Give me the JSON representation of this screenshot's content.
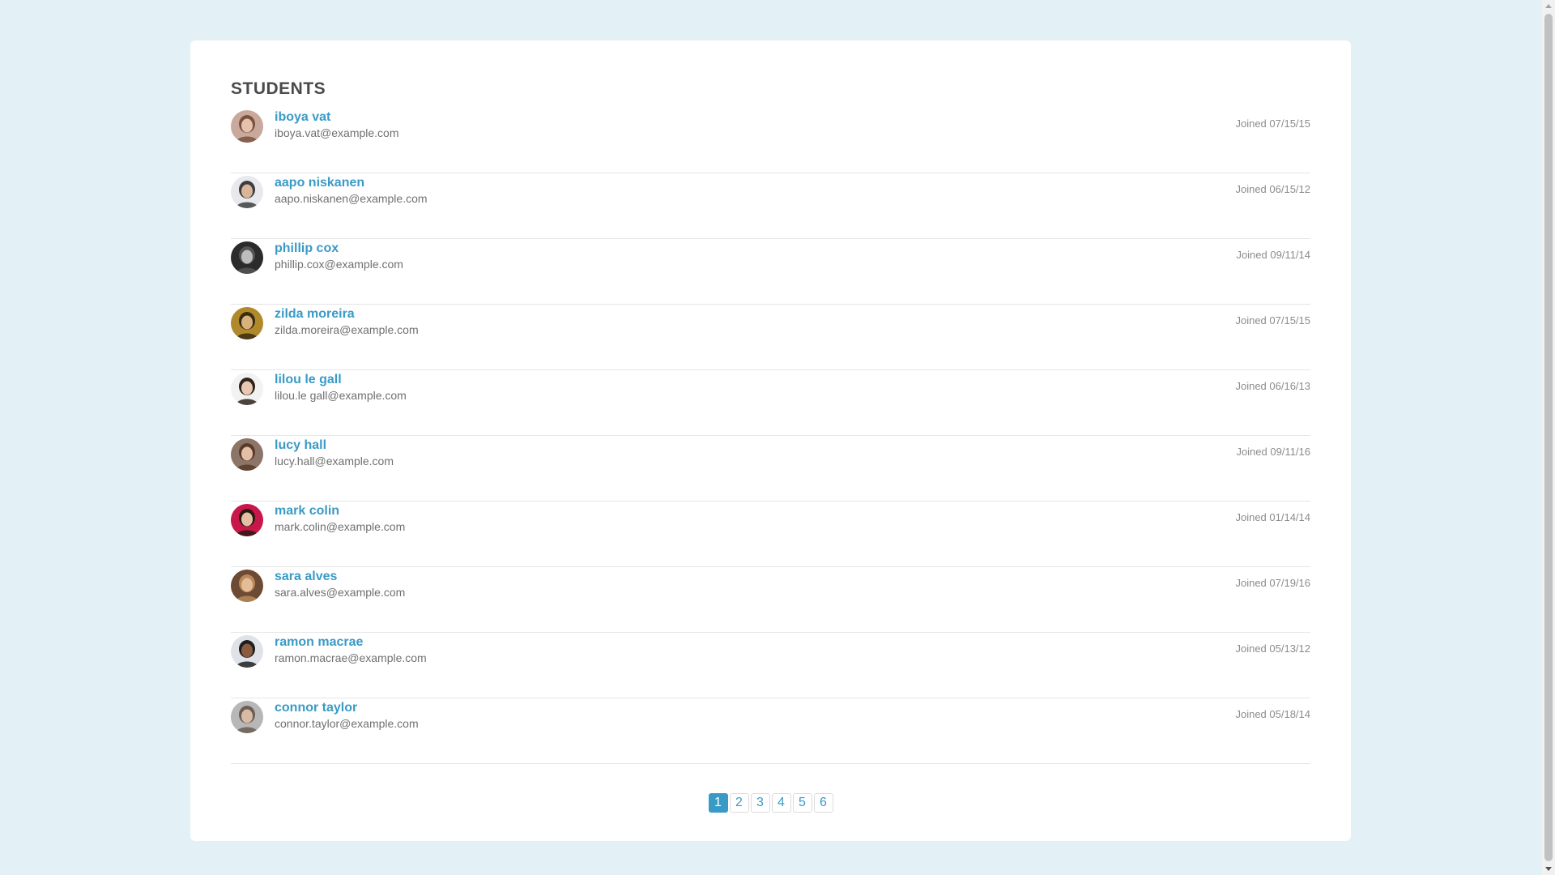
{
  "title": "STUDENTS",
  "students": [
    {
      "name": "iboya vat",
      "email": "iboya.vat@example.com",
      "joined": "Joined 07/15/15",
      "avatar_bg": "#c9a99b",
      "avatar_hair": "#7a5340",
      "avatar_skin": "#e6c2ad"
    },
    {
      "name": "aapo niskanen",
      "email": "aapo.niskanen@example.com",
      "joined": "Joined 06/15/12",
      "avatar_bg": "#e7e9ec",
      "avatar_hair": "#3d3d3d",
      "avatar_skin": "#d9b59c"
    },
    {
      "name": "phillip cox",
      "email": "phillip.cox@example.com",
      "joined": "Joined 09/11/14",
      "avatar_bg": "#2b2b2b",
      "avatar_hair": "#555555",
      "avatar_skin": "#bdbdbd"
    },
    {
      "name": "zilda moreira",
      "email": "zilda.moreira@example.com",
      "joined": "Joined 07/15/15",
      "avatar_bg": "#b08a2a",
      "avatar_hair": "#3a2b14",
      "avatar_skin": "#d9b27a"
    },
    {
      "name": "lilou le gall",
      "email": "lilou.le gall@example.com",
      "joined": "Joined 06/16/13",
      "avatar_bg": "#f2f2f2",
      "avatar_hair": "#2e2419",
      "avatar_skin": "#e8c7b5"
    },
    {
      "name": "lucy hall",
      "email": "lucy.hall@example.com",
      "joined": "Joined 09/11/16",
      "avatar_bg": "#8a7568",
      "avatar_hair": "#5a3b2a",
      "avatar_skin": "#e2bfa6"
    },
    {
      "name": "mark colin",
      "email": "mark.colin@example.com",
      "joined": "Joined 01/14/14",
      "avatar_bg": "#c8174a",
      "avatar_hair": "#2a1a12",
      "avatar_skin": "#e6c0a5"
    },
    {
      "name": "sara alves",
      "email": "sara.alves@example.com",
      "joined": "Joined 07/19/16",
      "avatar_bg": "#6d4a33",
      "avatar_hair": "#b9895a",
      "avatar_skin": "#e3bc98"
    },
    {
      "name": "ramon macrae",
      "email": "ramon.macrae@example.com",
      "joined": "Joined 05/13/12",
      "avatar_bg": "#dfe3e8",
      "avatar_hair": "#1e1e1e",
      "avatar_skin": "#8a5b3e"
    },
    {
      "name": "connor taylor",
      "email": "connor.taylor@example.com",
      "joined": "Joined 05/18/14",
      "avatar_bg": "#b7b7b7",
      "avatar_hair": "#6b5e55",
      "avatar_skin": "#d8bba6"
    }
  ],
  "pagination": {
    "pages": [
      "1",
      "2",
      "3",
      "4",
      "5",
      "6"
    ],
    "current": "1"
  },
  "colors": {
    "accent": "#3a9ac6",
    "page_background": "#e3f0f6"
  },
  "icons": {
    "avatar": "user-avatar-icon"
  }
}
